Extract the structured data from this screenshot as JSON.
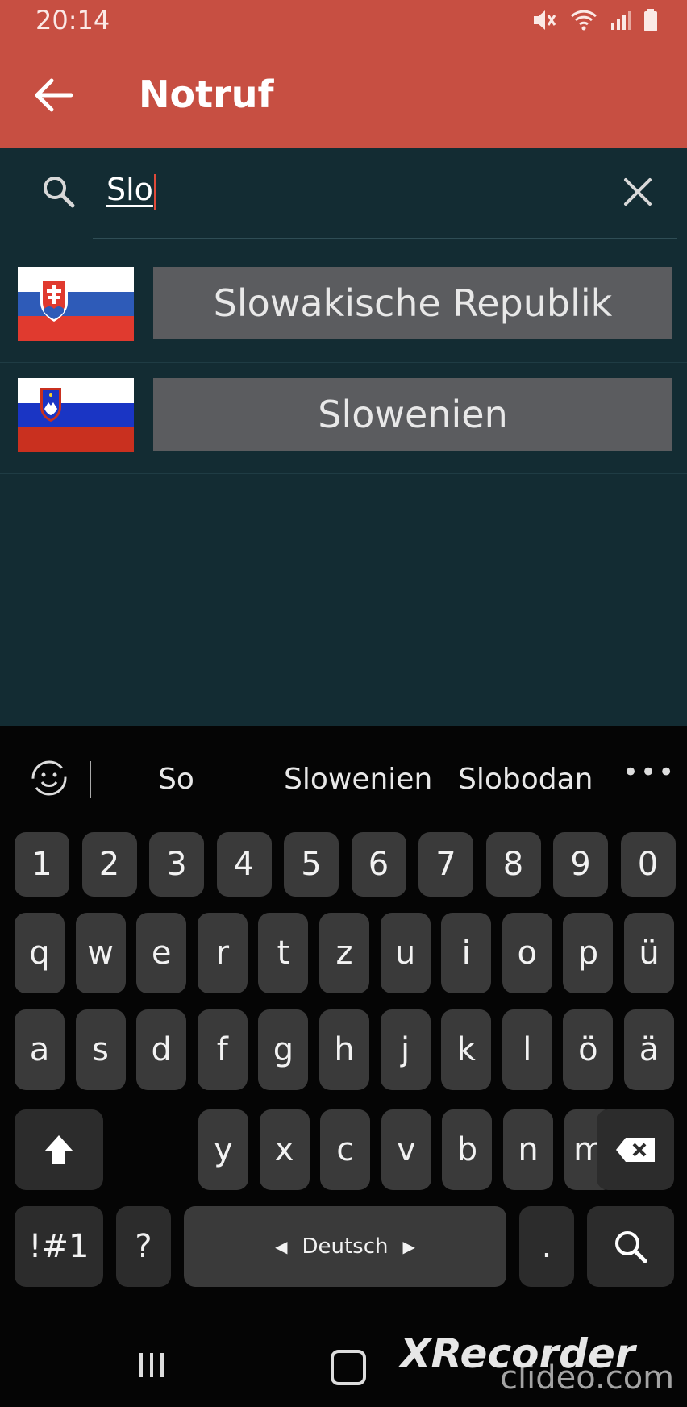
{
  "status_bar": {
    "time": "20:14"
  },
  "header": {
    "title": "Notruf"
  },
  "search": {
    "value": "Slo"
  },
  "results": [
    {
      "label": "Slowakische Republik",
      "flag": "slovakia-flag"
    },
    {
      "label": "Slowenien",
      "flag": "slovenia-flag"
    }
  ],
  "keyboard": {
    "suggestions": [
      "So",
      "Slowenien",
      "Slobodan"
    ],
    "row_numbers": [
      "1",
      "2",
      "3",
      "4",
      "5",
      "6",
      "7",
      "8",
      "9",
      "0"
    ],
    "row_top": [
      "q",
      "w",
      "e",
      "r",
      "t",
      "z",
      "u",
      "i",
      "o",
      "p",
      "ü"
    ],
    "row_mid": [
      "a",
      "s",
      "d",
      "f",
      "g",
      "h",
      "j",
      "k",
      "l",
      "ö",
      "ä"
    ],
    "row_bottom": [
      "y",
      "x",
      "c",
      "v",
      "b",
      "n",
      "m"
    ],
    "symbols_label": "!#1",
    "question_label": "?",
    "space_label": "Deutsch",
    "period_label": "."
  },
  "watermark": {
    "line1": "XRecorder",
    "line2": "clideo.com"
  },
  "colors": {
    "header": "#c74f42",
    "content": "#132c33",
    "button": "#5b5c5f",
    "caret": "#e04a3a"
  }
}
